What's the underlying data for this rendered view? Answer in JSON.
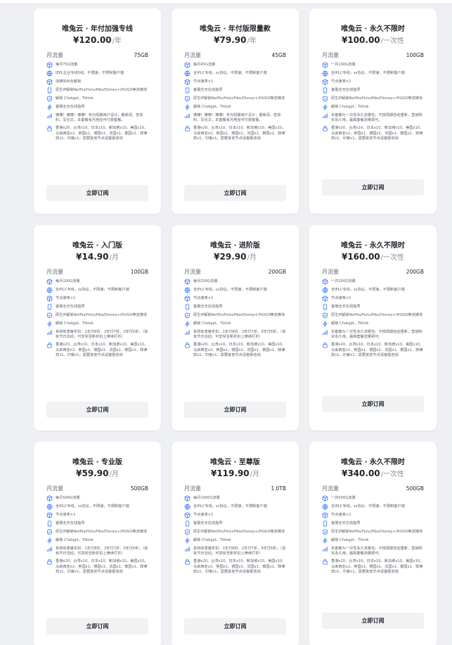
{
  "ui": {
    "traffic_label": "月流量",
    "subscribe_label": "立即订阅"
  },
  "cards": [
    {
      "title": "唯兔云 · 年付加强专线",
      "price": "¥120.00",
      "period": "/年",
      "traffic": "75GB",
      "features": [
        {
          "icon": "cube",
          "text": "每月75G流量"
        },
        {
          "icon": "globe",
          "text": "IEPL企业专线5线，不限速，不限制客户端"
        },
        {
          "icon": "cube",
          "text": "流媒体AI全解锁"
        },
        {
          "icon": "phone",
          "text": "原生IP解锁Netflix/Hulu/Hbo/Disney+/HUGO等流媒体"
        },
        {
          "icon": "shield",
          "text": "解锁 Chatgpt，Tiktok"
        },
        {
          "icon": "bolt",
          "text": "客服全天在线指导"
        },
        {
          "icon": "chart",
          "text": "擦擦！擦擦！擦擦！专为短期用户设计，看新闻、查资料、写论文，本套餐有月用完可付费套餐。"
        },
        {
          "icon": "lock",
          "text": "香港x20、台湾x10、日本x10、新加坡x10、美国x10、马来西亚x2、英国x1、德国x1、法国x1、泰国x1、菲律宾x1、印度x1，需要其他节点请客服咨询"
        }
      ]
    },
    {
      "title": "唯兔云 · 年付版限量款",
      "price": "¥79.90",
      "period": "/年",
      "traffic": "45GB",
      "features": [
        {
          "icon": "cube",
          "text": "每月45G流量"
        },
        {
          "icon": "globe",
          "text": "全IPLC专线，ss协议，不限速，不限制客户端"
        },
        {
          "icon": "cube",
          "text": "节点速率×1"
        },
        {
          "icon": "phone",
          "text": "客服全天在线指导"
        },
        {
          "icon": "shield",
          "text": "原生IP解锁Netflix/Hulu/Hbo/Disney+/HUGO等流媒体"
        },
        {
          "icon": "bolt",
          "text": "解锁 Chatgpt，Tiktok"
        },
        {
          "icon": "chart",
          "text": "擦擦！擦擦！擦擦！专为短期用户设计，看新闻、查资料、写论文，本套餐有月用完可付费套餐。"
        },
        {
          "icon": "lock",
          "text": "香港x20、台湾x10、日本x10、新加坡x10、美国x10、马来西亚x2、英国x1、德国x1、法国x1、泰国x1、菲律宾x1、印度x1，需要其他节点请客服咨询"
        }
      ]
    },
    {
      "title": "唯兔云 · 永久不限时",
      "price": "¥100.00",
      "period": "/一次性",
      "traffic": "100GB",
      "lifetime": true,
      "features": [
        {
          "icon": "cube",
          "text": "一共100G流量"
        },
        {
          "icon": "globe",
          "text": "全IPLC专线，ss协议，不限速，不限制客户端"
        },
        {
          "icon": "cube",
          "text": "节点速率×1"
        },
        {
          "icon": "phone",
          "text": "客服全天在线指导"
        },
        {
          "icon": "shield",
          "text": "原生IP解锁Netflix/Hulu/Hbo/Disney+/HUGO等流媒体"
        },
        {
          "icon": "bolt",
          "text": "解锁 Chatgpt，Tiktok"
        },
        {
          "icon": "chart",
          "text": "本套餐为一次性永久流量包，不按周期自动重新，直接购买永久用，最高套餐流量即可。"
        },
        {
          "icon": "lock",
          "text": "香港x20、台湾x10、日本x10、新加坡x10、美国x10、马来西亚x2、英国x1、德国x1、法国x1、泰国x1、菲律宾x1、印度x1，需要其他节点请客服咨询"
        }
      ]
    },
    {
      "title": "唯兔云 · 入门版",
      "price": "¥14.90",
      "period": "/月",
      "traffic": "100GB",
      "features": [
        {
          "icon": "cube",
          "text": "每月100G流量"
        },
        {
          "icon": "globe",
          "text": "全IPLC专线，ss协议，不限速，不限制客户端"
        },
        {
          "icon": "cube",
          "text": "节点速率×1"
        },
        {
          "icon": "phone",
          "text": "客服全天在线指导"
        },
        {
          "icon": "shield",
          "text": "原生IP解锁Netflix/Hulu/Hbo/Disney+/HUGO等流媒体"
        },
        {
          "icon": "bolt",
          "text": "解锁 Chatgpt，Tiktok"
        },
        {
          "icon": "chart",
          "text": "系统有季度折扣：1年付8折、2年付7折、3年付6折，（如有节日活动，可享受至新折扣上律续打折）"
        },
        {
          "icon": "lock",
          "text": "香港x20、台湾x10、日本x10、新加坡x10、美国x10、马来西亚x2、英国x1、德国x1、法国x1、泰国x1、菲律宾x1、印度x1，需要其他节点请客服咨询"
        }
      ]
    },
    {
      "title": "唯兔云 · 进阶版",
      "price": "¥29.90",
      "period": "/月",
      "traffic": "200GB",
      "features": [
        {
          "icon": "cube",
          "text": "每月200G流量"
        },
        {
          "icon": "globe",
          "text": "全IPLC专线，ss协议，不限速，不限制客户端"
        },
        {
          "icon": "cube",
          "text": "节点速率×1"
        },
        {
          "icon": "phone",
          "text": "客服全天在线指导"
        },
        {
          "icon": "shield",
          "text": "原生IP解锁Netflix/Hulu/Hbo/Disney+/HUGO等流媒体"
        },
        {
          "icon": "bolt",
          "text": "解锁 Chatgpt，Tiktok"
        },
        {
          "icon": "chart",
          "text": "系统有季度折扣：1年付8折、2年付7折、3年付6折，（如有节日活动，可享受至新折扣上律续打折）"
        },
        {
          "icon": "lock",
          "text": "香港x20、台湾x10、日本x10、新加坡x10、美国x10、马来西亚x2、英国x1、德国x1、法国x1、泰国x1、菲律宾x1、印度x1，需要其他节点请客服咨询"
        }
      ]
    },
    {
      "title": "唯兔云 · 永久不限时",
      "price": "¥160.00",
      "period": "/一次性",
      "traffic": "200GB",
      "lifetime": true,
      "features": [
        {
          "icon": "cube",
          "text": "一共200G流量"
        },
        {
          "icon": "globe",
          "text": "全IPLC专线，ss协议，不限速，不限制客户端"
        },
        {
          "icon": "cube",
          "text": "节点速率×1"
        },
        {
          "icon": "phone",
          "text": "客服全天在线指导"
        },
        {
          "icon": "shield",
          "text": "原生IP解锁Netflix/Hulu/Hbo/Disney+/HUGO等流媒体"
        },
        {
          "icon": "bolt",
          "text": "解锁 Chatgpt，Tiktok"
        },
        {
          "icon": "chart",
          "text": "本套餐为一次性永久流量包，不按周期自动重新，直接购买永久用，最高套餐流量即可。"
        },
        {
          "icon": "lock",
          "text": "香港x20、台湾x10、日本x10、新加坡x10、美国x10、马来西亚x2、英国x1、德国x1、法国x1、泰国x1、菲律宾x1、印度x1，需要其他节点请客服咨询"
        }
      ]
    },
    {
      "title": "唯兔云 · 专业版",
      "price": "¥59.90",
      "period": "/月",
      "traffic": "500GB",
      "features": [
        {
          "icon": "cube",
          "text": "每月500G流量"
        },
        {
          "icon": "globe",
          "text": "全IPLC专线，ss协议，不限速，不限制客户端"
        },
        {
          "icon": "cube",
          "text": "节点速率×1"
        },
        {
          "icon": "phone",
          "text": "客服全天在线指导"
        },
        {
          "icon": "shield",
          "text": "原生IP解锁Netflix/Hulu/Hbo/Disney+/HUGO等流媒体"
        },
        {
          "icon": "bolt",
          "text": "解锁 Chatgpt，Tiktok"
        },
        {
          "icon": "chart",
          "text": "系统有季度折扣：1年付8折、2年付7折、3年付6折，（如有节日活动，可享受至新折扣上律续打折）"
        },
        {
          "icon": "lock",
          "text": "香港x20、台湾x10、日本x10、新加坡x10、美国x10、马来西亚x2、英国x1、德国x1、法国x1、泰国x1、菲律宾x1、印度x1，需要其他节点请客服咨询"
        }
      ]
    },
    {
      "title": "唯兔云 · 至尊版",
      "price": "¥119.90",
      "period": "/月",
      "traffic": "1.0TB",
      "features": [
        {
          "icon": "cube",
          "text": "每月1000G流量"
        },
        {
          "icon": "globe",
          "text": "全IPLC专线，ss协议，不限速，不限制客户端"
        },
        {
          "icon": "cube",
          "text": "节点速率×1"
        },
        {
          "icon": "phone",
          "text": "客服全天在线指导"
        },
        {
          "icon": "shield",
          "text": "原生IP解锁Netflix/Hulu/Hbo/Disney+/HUGO等流媒体"
        },
        {
          "icon": "bolt",
          "text": "解锁 Chatgpt，Tiktok"
        },
        {
          "icon": "chart",
          "text": "系统有季度折扣：1年付8折、2年付7折、3年付6折，（如有节日活动，可享受至新折扣上律续打折）"
        },
        {
          "icon": "lock",
          "text": "香港x20、台湾x10、日本x10、新加坡x10、美国x10、马来西亚x2、英国x1、德国x1、法国x1、泰国x1、菲律宾x1、印度x1，需要其他节点请客服咨询"
        }
      ]
    },
    {
      "title": "唯兔云 · 永久不限时",
      "price": "¥340.00",
      "period": "/一次性",
      "traffic": "500GB",
      "lifetime": true,
      "features": [
        {
          "icon": "cube",
          "text": "一共500G流量"
        },
        {
          "icon": "globe",
          "text": "全IPLC专线，ss协议，不限速，不限制客户端"
        },
        {
          "icon": "cube",
          "text": "节点速率×1"
        },
        {
          "icon": "phone",
          "text": "客服全天在线指导"
        },
        {
          "icon": "shield",
          "text": "原生IP解锁Netflix/Hulu/Hbo/Disney+/HUGO等流媒体"
        },
        {
          "icon": "bolt",
          "text": "解锁 Chatgpt，Tiktok"
        },
        {
          "icon": "chart",
          "text": "本套餐为一次性永久流量包，不按周期自动重新，直接购买永久用，最高套餐流量即可。"
        },
        {
          "icon": "lock",
          "text": "香港x20、台湾x10、日本x10、新加坡x10、美国x10、马来西亚x2、英国x1、德国x1、法国x1、泰国x1、菲律宾x1、印度x1，需要其他节点请客服咨询"
        }
      ]
    }
  ],
  "colors": {
    "icon": "#3370ff",
    "button_bg": "#f1f2f4",
    "card_bg": "#ffffff",
    "page_bg": "#eef0f3"
  }
}
